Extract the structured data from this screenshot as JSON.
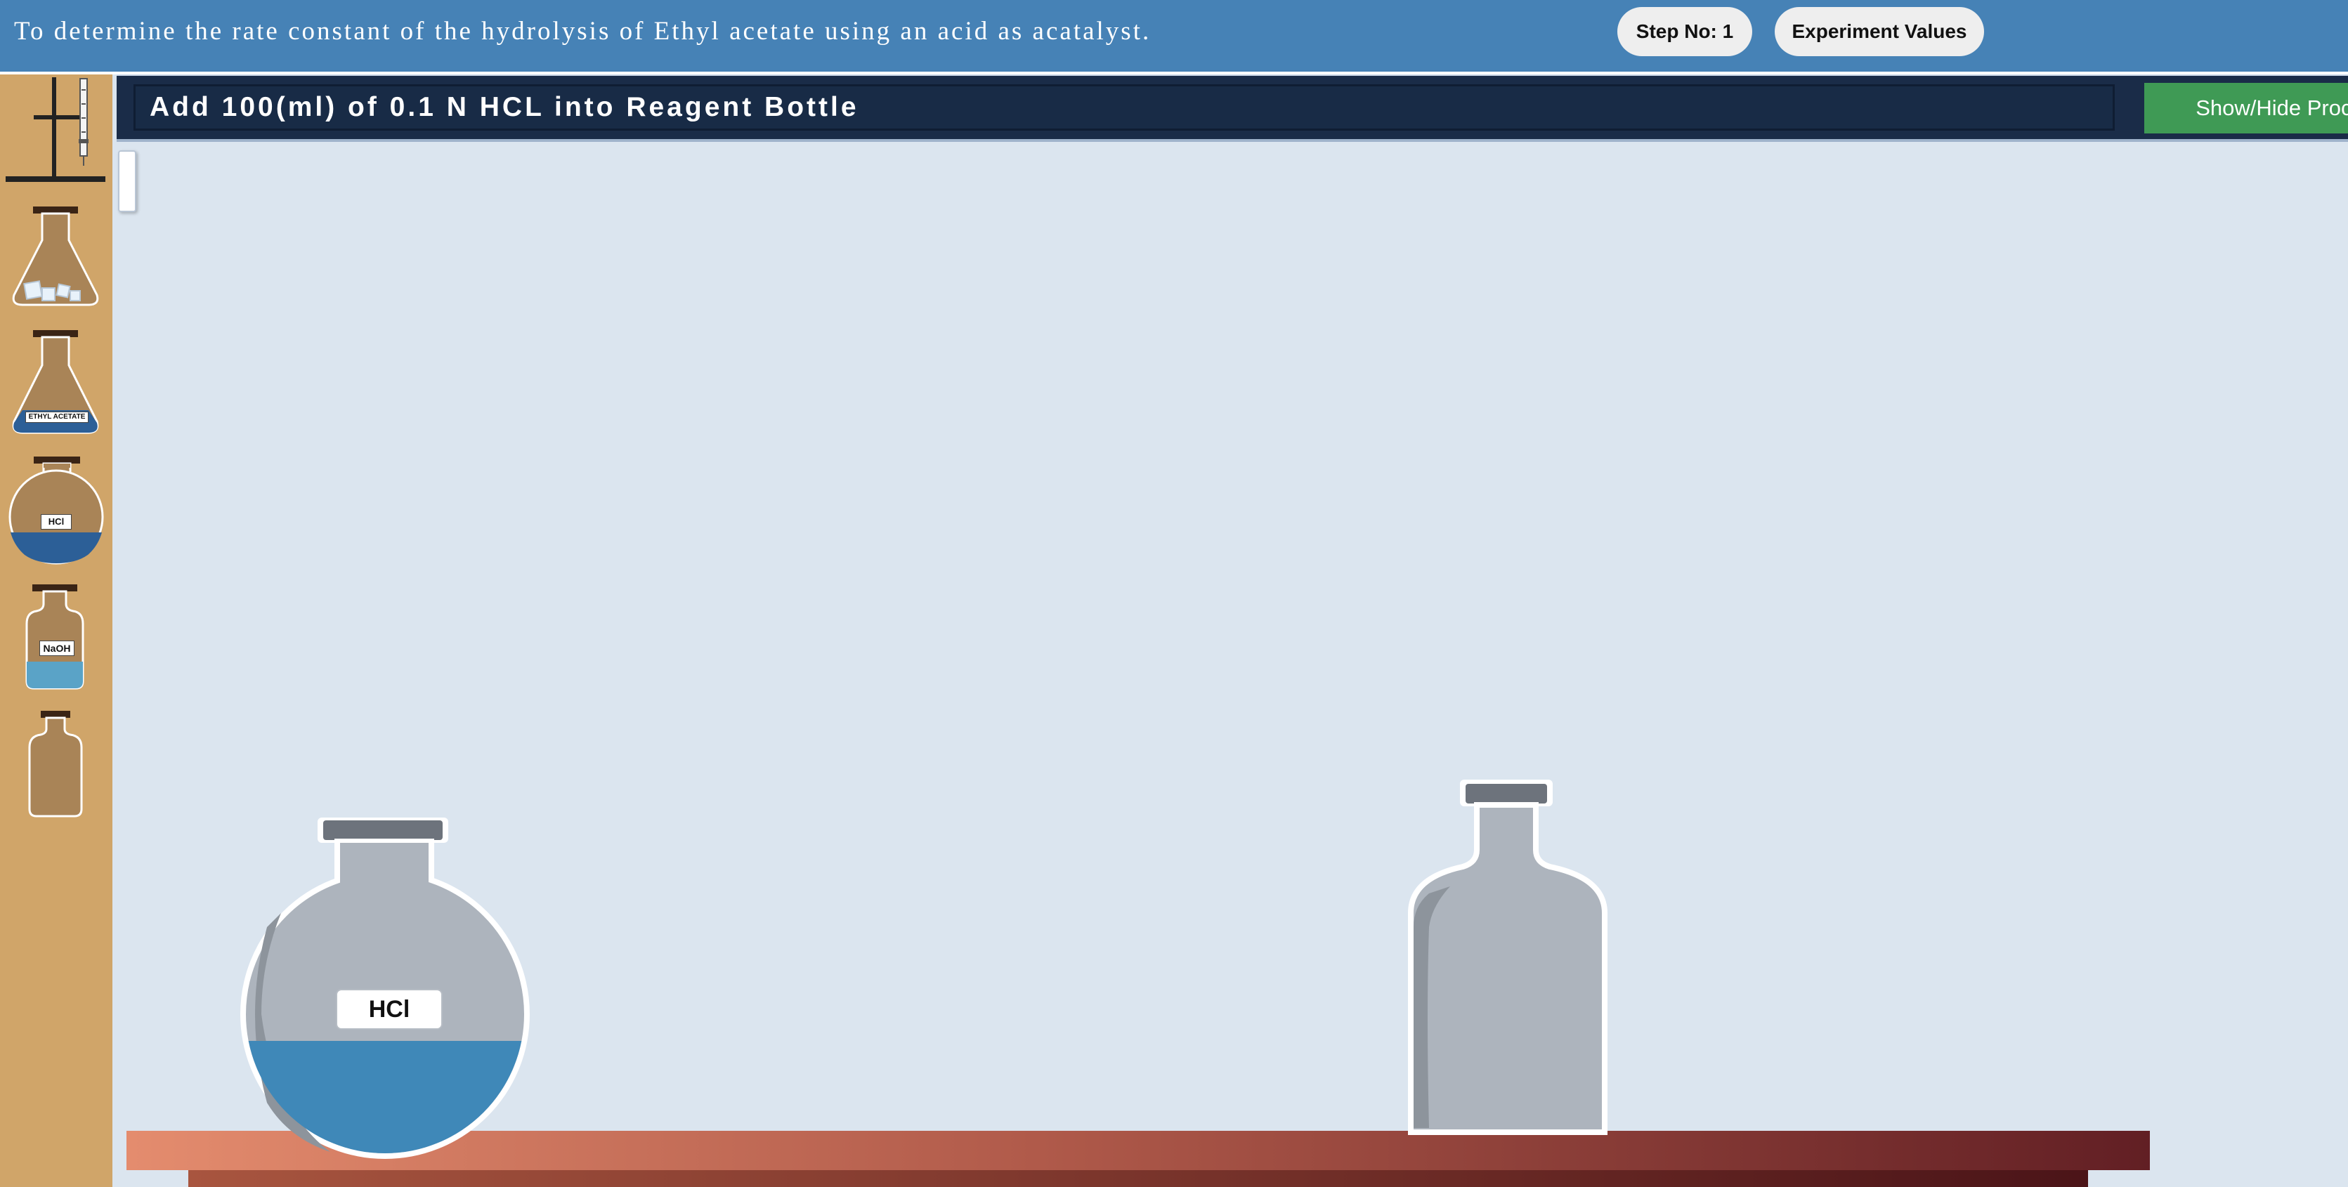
{
  "header": {
    "aim": "To determine the rate constant of the hydrolysis of Ethyl acetate using an acid as acatalyst.",
    "step_label": "Step No: 1",
    "experiment_values_label": "Experiment Values"
  },
  "instruction": {
    "text": "Add 100(ml) of 0.1 N HCL into Reagent Bottle",
    "procedure_button": "Show/Hide Procedure"
  },
  "sidebar": {
    "items": [
      {
        "name": "burette-stand",
        "label": ""
      },
      {
        "name": "ice-flask",
        "label": ""
      },
      {
        "name": "ethyl-acetate-flask",
        "label": "ETHYL ACETATE"
      },
      {
        "name": "hcl-flask",
        "label": "HCl"
      },
      {
        "name": "naoh-bottle",
        "label": "NaOH"
      },
      {
        "name": "empty-bottle",
        "label": ""
      }
    ]
  },
  "workbench": {
    "hcl_flask_label": "HCl"
  },
  "colors": {
    "header_bg": "#4682b6",
    "sidebar_bg": "#d0a569",
    "instruction_bg": "#1a2c48",
    "procedure_button": "#3f9a55",
    "canvas_bg": "#dbe5ef",
    "liquid_blue": "#3f88b8"
  }
}
